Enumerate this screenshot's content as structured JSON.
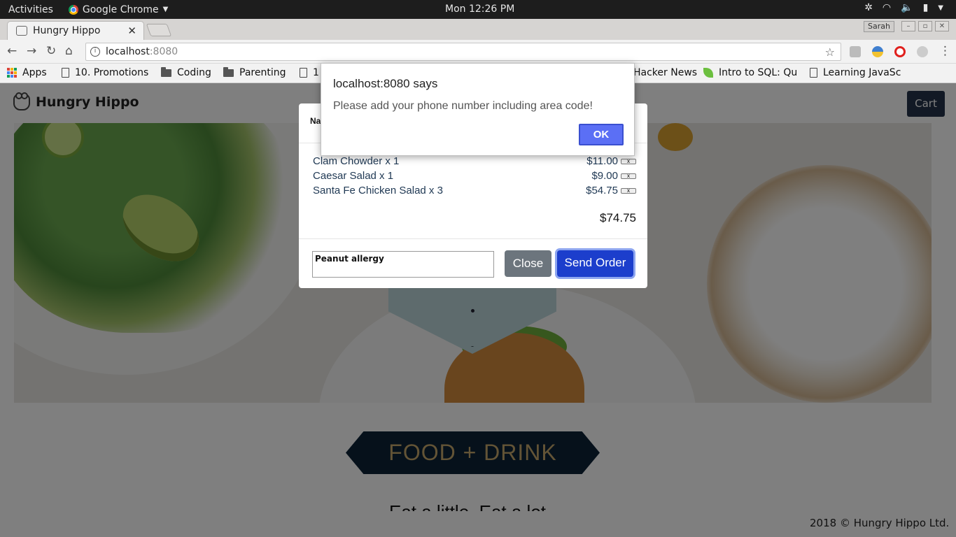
{
  "system_bar": {
    "activities": "Activities",
    "app_name": "Google Chrome",
    "clock": "Mon 12:26 PM"
  },
  "browser": {
    "tab_title": "Hungry Hippo",
    "user": "Sarah",
    "url_host": "localhost",
    "url_port": ":8080",
    "bookmarks": [
      {
        "label": "Apps",
        "icon": "apps-grid-icon"
      },
      {
        "label": "10. Promotions",
        "icon": "page-icon"
      },
      {
        "label": "Coding",
        "icon": "folder-icon"
      },
      {
        "label": "Parenting",
        "icon": "folder-icon"
      },
      {
        "label": "1",
        "icon": "page-icon"
      },
      {
        "label": "Hacker News",
        "icon": ""
      },
      {
        "label": "Intro to SQL: Qu",
        "icon": "leaf-icon"
      },
      {
        "label": "Learning JavaSc",
        "icon": "page-icon"
      }
    ]
  },
  "site": {
    "brand": "Hungry Hippo",
    "cart_label": "Cart",
    "banner": "FOOD + DRINK",
    "subhead": "Eat a little. Eat a lot.",
    "footer": "2018 © Hungry Hippo Ltd."
  },
  "modal": {
    "header_text": "Na",
    "items": [
      {
        "name": "Clam Chowder x 1",
        "price": "$11.00",
        "remove": "x"
      },
      {
        "name": "Caesar Salad x 1",
        "price": "$9.00",
        "remove": "x"
      },
      {
        "name": "Santa Fe Chicken Salad x 3",
        "price": "$54.75",
        "remove": "x"
      }
    ],
    "total": "$74.75",
    "notes_value": "Peanut allergy",
    "close_label": "Close",
    "send_label": "Send Order"
  },
  "alert": {
    "title": "localhost:8080 says",
    "message": "Please add your phone number including area code!",
    "ok_label": "OK"
  },
  "colors": {
    "cart_button": "#24324a",
    "send_button": "#1c3ecc",
    "close_button": "#6c757d",
    "banner_bg": "#0d2237",
    "banner_text": "#c7a86c",
    "ok_button": "#5b6ff5"
  }
}
